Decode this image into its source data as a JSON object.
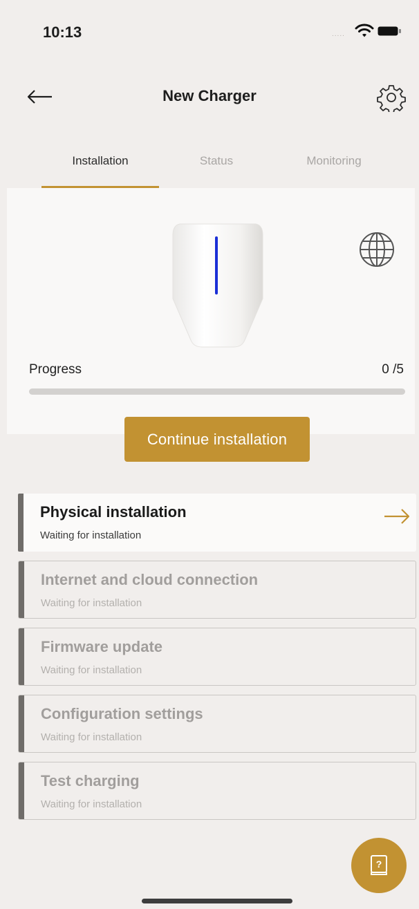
{
  "status_bar": {
    "time": "10:13",
    "signal": "....."
  },
  "header": {
    "title": "New Charger",
    "back_icon": "arrow-left-icon",
    "settings_icon": "gear-icon"
  },
  "tabs": [
    {
      "label": "Installation",
      "selected": true
    },
    {
      "label": "Status",
      "selected": false
    },
    {
      "label": "Monitoring",
      "selected": false
    }
  ],
  "hero": {
    "image": "wallbox-charger",
    "globe_icon": "globe-icon"
  },
  "progress": {
    "label": "Progress",
    "count": "0 /5",
    "fraction": 0
  },
  "actions": {
    "continue_label": "Continue installation"
  },
  "steps": [
    {
      "title": "Physical installation",
      "status": "Waiting for installation",
      "active": true
    },
    {
      "title": "Internet and cloud connection",
      "status": "Waiting for installation",
      "active": false
    },
    {
      "title": "Firmware update",
      "status": "Waiting for installation",
      "active": false
    },
    {
      "title": "Configuration settings",
      "status": "Waiting for installation",
      "active": false
    },
    {
      "title": "Test charging",
      "status": "Waiting for installation",
      "active": false
    }
  ],
  "help": {
    "icon": "help-book-icon"
  },
  "colors": {
    "accent": "#c29232",
    "background": "#f1eeec",
    "card": "#f9f8f7",
    "step_bar": "#6f6c69"
  }
}
